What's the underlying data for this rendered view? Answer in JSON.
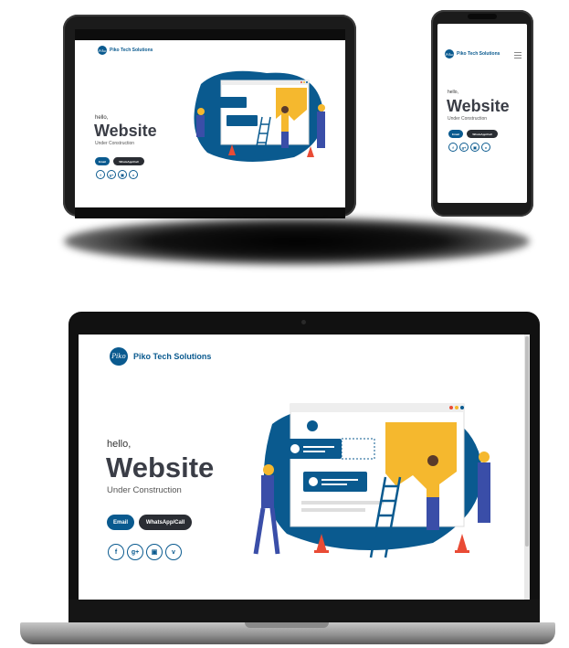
{
  "brand": {
    "name": "Piko Tech Solutions",
    "logo_mark": "Piko"
  },
  "hero": {
    "greeting": "hello,",
    "headline": "Website",
    "subheadline": "Under Construction"
  },
  "buttons": {
    "email": "Email",
    "whatsapp": "WhatsApp/Call"
  },
  "socials": [
    {
      "icon": "facebook-icon",
      "glyph": "f"
    },
    {
      "icon": "google-plus-icon",
      "glyph": "g+"
    },
    {
      "icon": "instagram-icon",
      "glyph": "▣"
    },
    {
      "icon": "twitter-icon",
      "glyph": "v"
    }
  ],
  "colors": {
    "brand_blue": "#0a5a8f",
    "dark_button": "#2a2d33",
    "headline": "#3a3d46",
    "accent_yellow": "#f5b82e",
    "cone_red": "#e94b35"
  }
}
